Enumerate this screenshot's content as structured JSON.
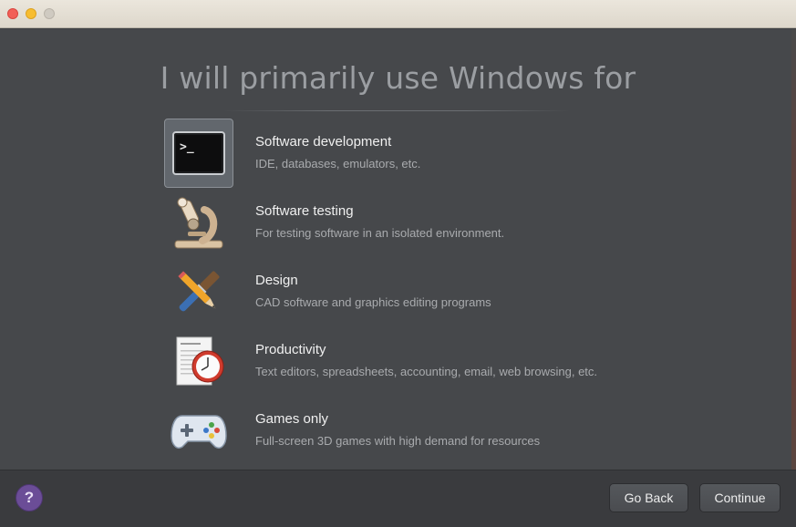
{
  "window": {
    "heading": "I will primarily use Windows for"
  },
  "options": [
    {
      "title": "Software development",
      "description": "IDE, databases, emulators, etc.",
      "icon": "terminal-icon",
      "selected": true,
      "terminal_prompt": ">_"
    },
    {
      "title": "Software testing",
      "description": "For testing software in an isolated environment.",
      "icon": "microscope-icon",
      "selected": false
    },
    {
      "title": "Design",
      "description": "CAD software and graphics editing programs",
      "icon": "brush-pencil-icon",
      "selected": false
    },
    {
      "title": "Productivity",
      "description": "Text editors, spreadsheets, accounting, email, web browsing, etc.",
      "icon": "document-clock-icon",
      "selected": false
    },
    {
      "title": "Games only",
      "description": "Full-screen 3D games with high demand for resources",
      "icon": "gamepad-icon",
      "selected": false
    }
  ],
  "footer": {
    "help_label": "?",
    "back_label": "Go Back",
    "continue_label": "Continue"
  },
  "colors": {
    "background": "#46484b",
    "selected_tile": "#62676d",
    "help_button": "#6b4d97"
  }
}
